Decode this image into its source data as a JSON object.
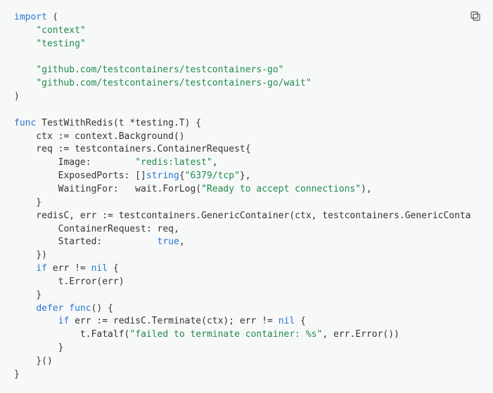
{
  "copy_label": "Copy",
  "code": {
    "import_kw": "import",
    "open_paren": " (",
    "pkg_context": "\"context\"",
    "pkg_testing": "\"testing\"",
    "pkg_tc": "\"github.com/testcontainers/testcontainers-go\"",
    "pkg_wait": "\"github.com/testcontainers/testcontainers-go/wait\"",
    "close_paren": ")",
    "func_kw": "func",
    "func_sig_pre": " TestWithRedis(t *testing.T) {",
    "ctx_line": "    ctx := context.Background()",
    "req_line": "    req := testcontainers.ContainerRequest{",
    "image_key": "        Image:        ",
    "image_val": "\"redis:latest\"",
    "image_comma": ",",
    "ports_key": "        ExposedPorts: []",
    "string_kw": "string",
    "ports_open": "{",
    "ports_val": "\"6379/tcp\"",
    "ports_close": "},",
    "wait_key": "        WaitingFor:   wait.ForLog(",
    "wait_val": "\"Ready to accept connections\"",
    "wait_close": "),",
    "req_close": "    }",
    "gc_line": "    redisC, err := testcontainers.GenericContainer(ctx, testcontainers.GenericConta",
    "gc_creq_key": "        ContainerRequest: req,",
    "gc_started_key": "        Started:          ",
    "true_kw": "true",
    "gc_started_comma": ",",
    "gc_close": "    })",
    "if_kw": "if",
    "if_cond": " err != ",
    "nil_kw": "nil",
    "if_open": " {",
    "err_line": "        t.Error(err)",
    "if_close": "    }",
    "defer_kw": "defer",
    "defer_func_kw": "func",
    "defer_open": "() {",
    "inner_if_kw": "if",
    "inner_if_pre": " err := redisC.Terminate(ctx); err != ",
    "inner_nil_kw": "nil",
    "inner_if_open": " {",
    "fatal_pre": "            t.Fatalf(",
    "fatal_str": "\"failed to terminate container: %s\"",
    "fatal_post": ", err.Error())",
    "inner_if_close": "        }",
    "defer_close": "    }()",
    "func_close": "}"
  }
}
